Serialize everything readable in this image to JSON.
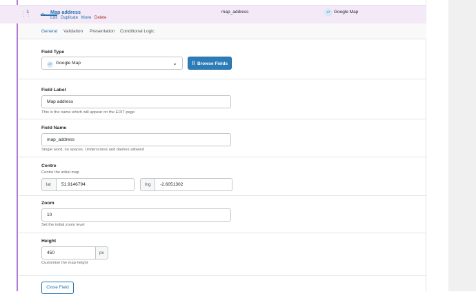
{
  "field": {
    "order": "1",
    "title": "Map address",
    "actions": {
      "edit": "Edit",
      "duplicate": "Duplicate",
      "move": "Move",
      "delete": "Delete"
    },
    "key": "map_address",
    "type": "Google Map"
  },
  "tabs": [
    {
      "label": "General",
      "active": true
    },
    {
      "label": "Validation"
    },
    {
      "label": "Presentation"
    },
    {
      "label": "Conditional Logic"
    }
  ],
  "field_type": {
    "label": "Field Type",
    "value": "Google Map",
    "browse_label": "Browse Fields"
  },
  "field_label": {
    "label": "Field Label",
    "value": "Map address",
    "help": "This is the name which will appear on the EDIT page"
  },
  "field_name": {
    "label": "Field Name",
    "value": "map_address",
    "help": "Single word, no spaces. Underscores and dashes allowed"
  },
  "centre": {
    "label": "Centre",
    "help": "Centre the initial map",
    "lat_label": "lat",
    "lat_value": "51.9146794",
    "lng_label": "lng",
    "lng_value": "-2.6051302"
  },
  "zoom": {
    "label": "Zoom",
    "value": "10",
    "help": "Set the initial zoom level"
  },
  "height": {
    "label": "Height",
    "value": "450",
    "unit": "px",
    "help": "Customise the map height"
  },
  "close_label": "Close Field",
  "colors": {
    "accent": "#2271b1",
    "header_bg": "#f4e9f7",
    "left_border": "#b07ad6",
    "delete": "#b32d2e"
  }
}
